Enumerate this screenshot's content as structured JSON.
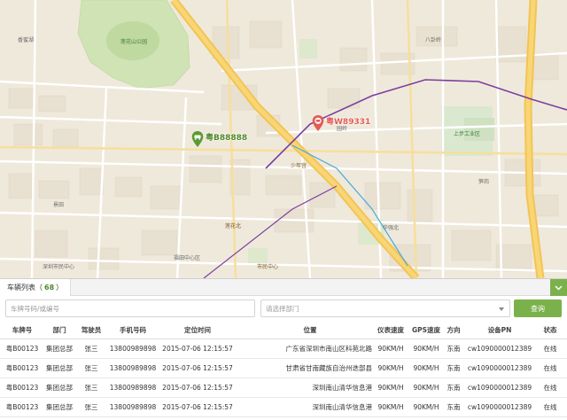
{
  "map": {
    "markers": [
      {
        "id": "green",
        "plate": "粤B88888",
        "color": "#4f8a2b"
      },
      {
        "id": "red",
        "plate": "粤W89331",
        "color": "#e35b55"
      }
    ],
    "labels": {
      "park": "莲花山公园",
      "metro_1": "莲花北",
      "metro_2": "少年宫",
      "metro_3": "市民中心",
      "metro_4": "会展中心",
      "area_1": "景田",
      "area_2": "香蜜湖",
      "area_3": "八卦岭",
      "area_4": "园岭",
      "area_5": "华强北",
      "area_6": "上步工业区",
      "area_7": "笋岗",
      "area_8": "福田中心区",
      "area_9": "深圳市民中心"
    }
  },
  "panel": {
    "title": "车辆列表",
    "count_open": "（",
    "count": "68",
    "count_close": "）",
    "plate_placeholder": "车牌号码/或编号",
    "dept_placeholder": "请选择部门",
    "search_label": "查询",
    "columns": [
      "车牌号",
      "部门",
      "驾驶员",
      "手机号码",
      "定位时间",
      "位置",
      "仪表速度",
      "GPS速度",
      "方向",
      "设备PN",
      "状态"
    ],
    "rows": [
      [
        "粤B00123",
        "集团总部",
        "张三",
        "13800989898",
        "2015-07-06 12:15:57",
        "广东省深圳市南山区科苑北路",
        "90KM/H",
        "90KM/H",
        "东南",
        "cw1090000012389",
        "在线"
      ],
      [
        "粤B00123",
        "集团总部",
        "张三",
        "13800989898",
        "2015-07-06 12:15:57",
        "甘肃省甘南藏族自治州迭部县",
        "90KM/H",
        "90KM/H",
        "东南",
        "cw1090000012389",
        "在线"
      ],
      [
        "粤B00123",
        "集团总部",
        "张三",
        "13800989898",
        "2015-07-06 12:15:57",
        "深圳南山清华信息港",
        "90KM/H",
        "90KM/H",
        "东南",
        "cw1090000012389",
        "在线"
      ],
      [
        "粤B00123",
        "集团总部",
        "张三",
        "13800989898",
        "2015-07-06 12:15:57",
        "深圳南山清华信息港",
        "90KM/H",
        "90KM/H",
        "东南",
        "cw1090000012389",
        "在线"
      ]
    ]
  },
  "colors": {
    "accent": "#7bb14b",
    "marker_green": "#4f8a2b",
    "marker_red": "#e35b55"
  },
  "icons": {
    "collapse": "chevron-down-icon",
    "select": "caret-down-icon",
    "vehicle": "car-pin-icon"
  }
}
